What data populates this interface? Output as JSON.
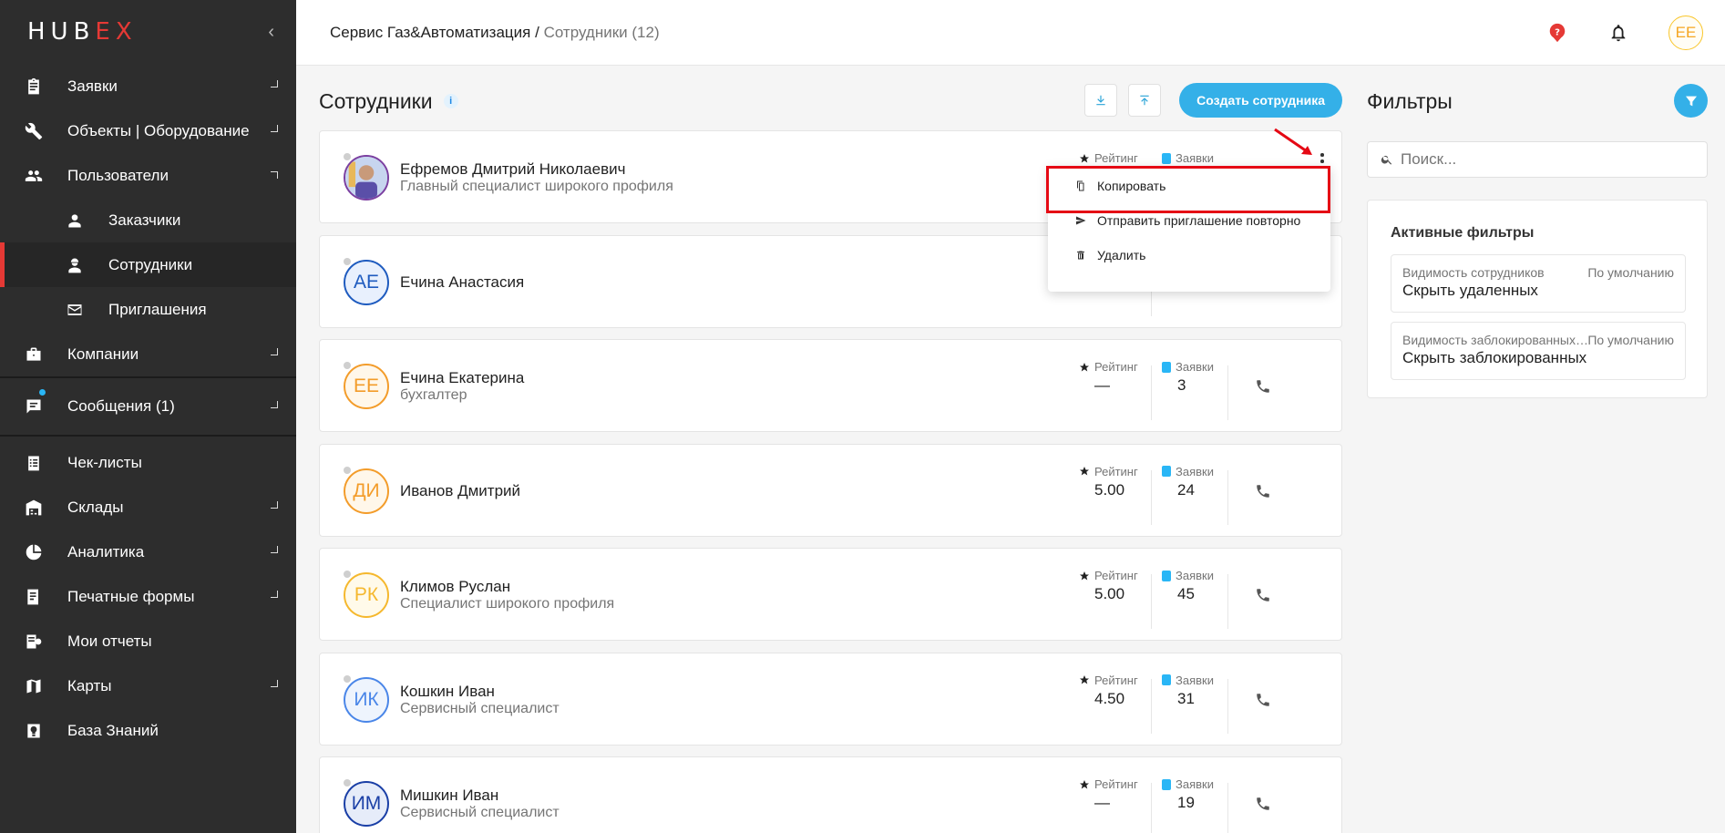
{
  "sidebar": {
    "logo_main": "HUB",
    "logo_accent": "EX",
    "items": [
      {
        "label": "Заявки",
        "icon": "clipboard-icon"
      },
      {
        "label": "Объекты | Оборудование",
        "icon": "wrench-icon"
      },
      {
        "label": "Пользователи",
        "icon": "users-icon"
      },
      {
        "label": "Заказчики",
        "icon": "customer-icon"
      },
      {
        "label": "Сотрудники",
        "icon": "worker-icon"
      },
      {
        "label": "Приглашения",
        "icon": "invitation-icon"
      },
      {
        "label": "Компании",
        "icon": "briefcase-icon"
      },
      {
        "label": "Сообщения (1)",
        "icon": "message-icon"
      },
      {
        "label": "Чек-листы",
        "icon": "checklist-icon"
      },
      {
        "label": "Склады",
        "icon": "warehouse-icon"
      },
      {
        "label": "Аналитика",
        "icon": "pie-chart-icon"
      },
      {
        "label": "Печатные формы",
        "icon": "print-form-icon"
      },
      {
        "label": "Мои отчеты",
        "icon": "report-icon"
      },
      {
        "label": "Карты",
        "icon": "map-icon"
      },
      {
        "label": "База Знаний",
        "icon": "knowledge-icon"
      }
    ]
  },
  "topbar": {
    "breadcrumb_root": "Сервис Газ&Автоматизация",
    "breadcrumb_sep": "/",
    "breadcrumb_current": "Сотрудники (12)",
    "user_initials": "ЕЕ"
  },
  "main": {
    "title": "Сотрудники",
    "create_button": "Создать сотрудника",
    "rating_label": "Рейтинг",
    "orders_label": "Заявки",
    "employees": [
      {
        "name": "Ефремов Дмитрий Николаевич",
        "role": "Главный специалист широкого профиля",
        "initials": "",
        "rating": "",
        "orders": "",
        "color": "#7b3fa0"
      },
      {
        "name": "Ечина Анастасия",
        "role": "",
        "initials": "АЕ",
        "rating": "",
        "orders": "",
        "color": "#1e5bbf"
      },
      {
        "name": "Ечина Екатерина",
        "role": "бухгалтер",
        "initials": "ЕЕ",
        "rating": "—",
        "orders": "3",
        "color": "#f39c2a"
      },
      {
        "name": "Иванов Дмитрий",
        "role": "",
        "initials": "ДИ",
        "rating": "5.00",
        "orders": "24",
        "color": "#f39c2a"
      },
      {
        "name": "Климов Руслан",
        "role": "Специалист широкого профиля",
        "initials": "РК",
        "rating": "5.00",
        "orders": "45",
        "color": "#f5b82e"
      },
      {
        "name": "Кошкин Иван",
        "role": "Сервисный специалист",
        "initials": "ИК",
        "rating": "4.50",
        "orders": "31",
        "color": "#4a86e8"
      },
      {
        "name": "Мишкин Иван",
        "role": "Сервисный специалист",
        "initials": "ИМ",
        "rating": "—",
        "orders": "19",
        "color": "#1a3fa6"
      }
    ]
  },
  "context_menu": {
    "copy": "Копировать",
    "resend": "Отправить приглашение повторно",
    "delete": "Удалить"
  },
  "filters": {
    "title": "Фильтры",
    "search_placeholder": "Поиск...",
    "active_title": "Активные фильтры",
    "items": [
      {
        "label": "Видимость сотрудников",
        "mode": "По умолчанию",
        "value": "Скрыть удаленных"
      },
      {
        "label": "Видимость заблокированных сотрудников",
        "mode": "По умолчанию",
        "value": "Скрыть заблокированных"
      }
    ]
  }
}
